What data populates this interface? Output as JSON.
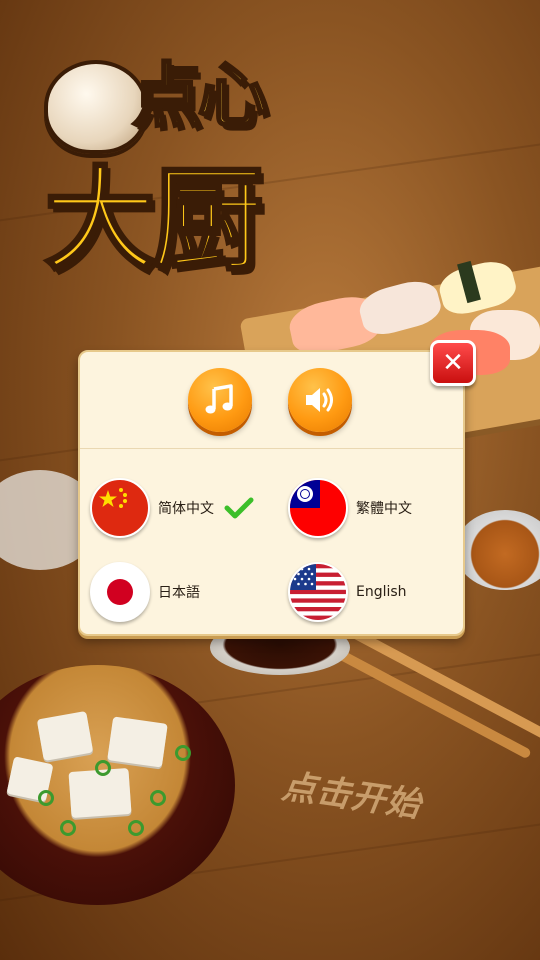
{
  "game": {
    "logo_top": "点心",
    "logo_bottom": "大厨",
    "start_prompt": "点击开始"
  },
  "settings_dialog": {
    "close_icon": "close-x-icon",
    "music_icon": "music-note-icon",
    "sound_icon": "speaker-icon",
    "languages": [
      {
        "label": "简体中文",
        "flag": "china-flag-icon",
        "selected": true
      },
      {
        "label": "繁體中文",
        "flag": "taiwan-flag-icon",
        "selected": false
      },
      {
        "label": "日本語",
        "flag": "japan-flag-icon",
        "selected": false
      },
      {
        "label": "English",
        "flag": "usa-flag-icon",
        "selected": false
      }
    ],
    "selected_indicator": "checkmark-icon"
  },
  "colors": {
    "button_orange": "#ff9a12",
    "close_red": "#e21c1c",
    "check_green": "#3cbf2a",
    "dialog_bg": "#fdf4de"
  }
}
